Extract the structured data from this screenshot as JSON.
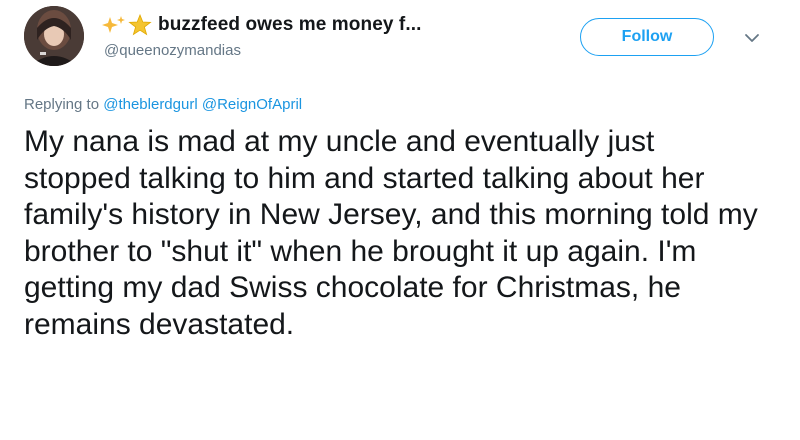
{
  "tweet": {
    "display_name": "buzzfeed owes me money f...",
    "handle": "@queenozymandias",
    "follow_label": "Follow",
    "reply": {
      "prefix": "Replying to",
      "mentions": [
        "@theblerdgurl",
        "@ReignOfApril"
      ]
    },
    "text": "My nana is mad at my uncle and eventually just stopped talking to him and started talking about her family's history in New Jersey, and this morning told my brother to \"shut it\" when he brought it up again. I'm getting my dad Swiss chocolate for Christmas, he remains devastated.",
    "icons": {
      "name_emoji": [
        "sparkle-icon",
        "star-icon"
      ],
      "menu": "chevron-down-icon"
    },
    "colors": {
      "accent": "#1da1f2",
      "mention": "#1b95e0",
      "secondary_text": "#657786",
      "primary_text": "#14171a"
    }
  }
}
